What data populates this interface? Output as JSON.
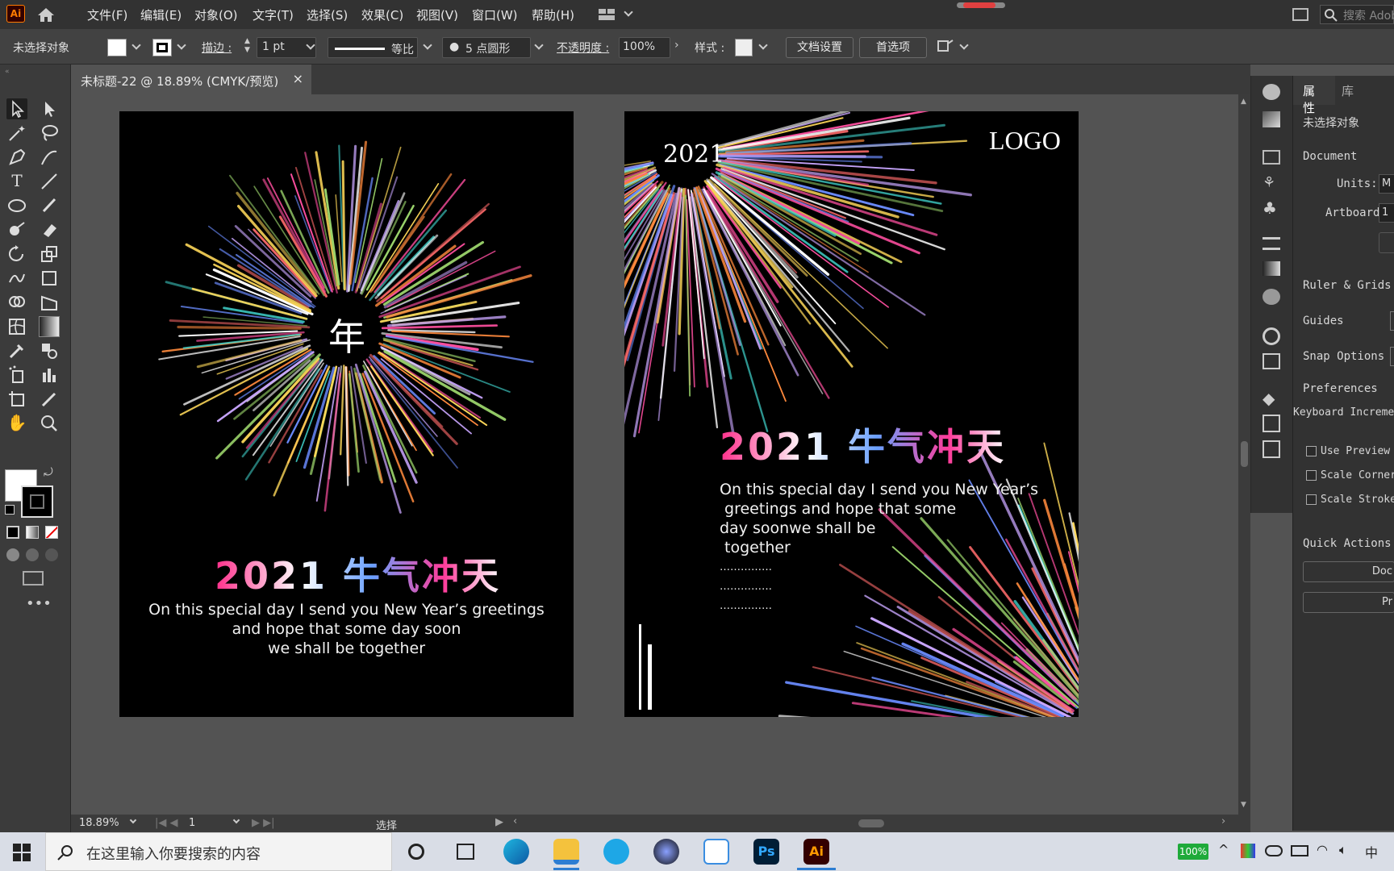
{
  "app": {
    "logo": "Ai",
    "menus": [
      "文件(F)",
      "编辑(E)",
      "对象(O)",
      "文字(T)",
      "选择(S)",
      "效果(C)",
      "视图(V)",
      "窗口(W)",
      "帮助(H)"
    ],
    "search_placeholder": "搜索 Adob"
  },
  "control": {
    "selection": "未选择对象",
    "stroke_label": "描边 :",
    "stroke_value": "1 pt",
    "stroke_style": "等比",
    "brush": "5 点圆形",
    "opacity_label": "不透明度 :",
    "opacity_value": "100%",
    "style_label": "样式 :",
    "doc_setup": "文档设置",
    "preferences": "首选项"
  },
  "tab": {
    "title": "未标题-22 @ 18.89% (CMYK/预览)",
    "close": "×"
  },
  "artboard1": {
    "center_char": "年",
    "headline": "2021 牛气冲天",
    "body": [
      "On this special day I send you New Year’s greetings",
      "and hope that some day soon",
      "we shall be together"
    ]
  },
  "artboard2": {
    "year": "2021",
    "logo": "LOGO",
    "headline": "2021 牛气冲天",
    "body": [
      "On this special day I send you New Year’s",
      " greetings and hope that some",
      "day soonwe shall be",
      " together"
    ],
    "dots": [
      "……………",
      "……………",
      "……………"
    ]
  },
  "status": {
    "zoom": "18.89%",
    "page": "1",
    "mode": "选择"
  },
  "panel": {
    "tabs": [
      "属性",
      "库"
    ],
    "selection": "未选择对象",
    "document": "Document",
    "units_label": "Units:",
    "units_value": "M",
    "artboard_label": "Artboard:",
    "artboard_value": "1",
    "ruler": "Ruler & Grids",
    "guides": "Guides",
    "snap": "Snap Options",
    "prefs": "Preferences",
    "keyboard": "Keyboard Incremen",
    "use_preview": "Use Preview",
    "scale_corners": "Scale Corner",
    "scale_strokes": "Scale Stroke",
    "quick_actions": "Quick Actions",
    "qa_btn1": "Doc",
    "qa_btn2": "Pr"
  },
  "taskbar": {
    "search_placeholder": "在这里输入你要搜索的内容",
    "battery": "100%",
    "ime": "中"
  },
  "colors": {
    "accent_pink": "#ff2e8a",
    "accent_blue": "#6aa0ff",
    "ai_brand": "#ff7c00"
  }
}
